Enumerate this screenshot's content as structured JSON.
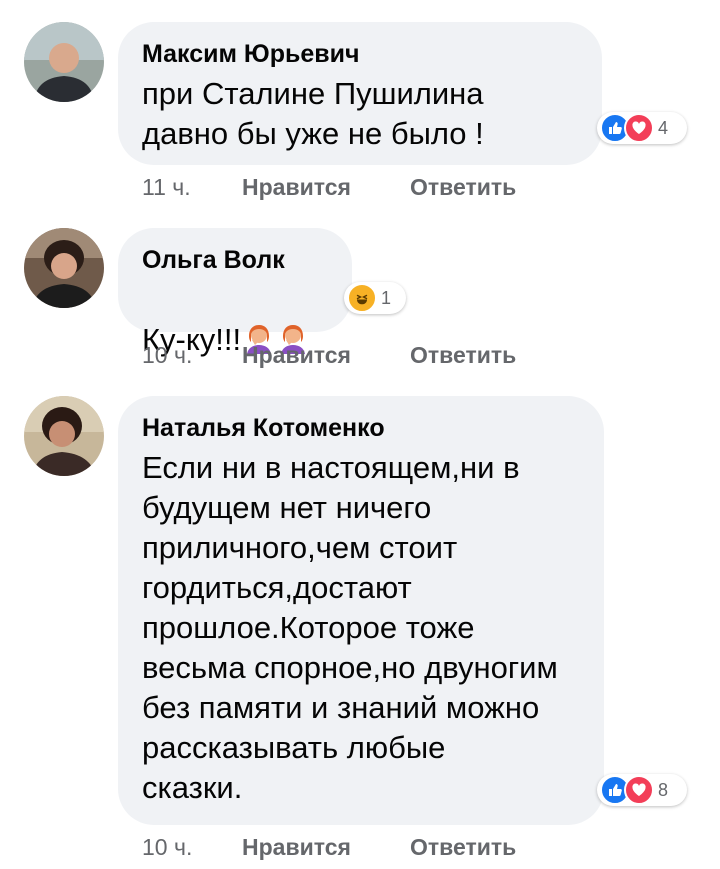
{
  "comments": [
    {
      "author": "Максим Юрьевич",
      "text": "при Сталине Пушилина\nдавно бы уже не было !",
      "reaction_count": "4",
      "time": "11 ч.",
      "like_label": "Нравится",
      "reply_label": "Ответить",
      "reactions": [
        "like-icon",
        "love-icon"
      ]
    },
    {
      "author": "Ольга Волк",
      "text": "Ку-ку!!!",
      "emoji": "face-palm-woman-emoji",
      "reaction_count": "1",
      "time": "10 ч.",
      "like_label": "Нравится",
      "reply_label": "Ответить",
      "reactions": [
        "haha-icon"
      ]
    },
    {
      "author": "Наталья Котоменко",
      "text": "Если ни в настоящем,ни в\nбудущем нет ничего\nприличного,чем стоит\nгордиться,достают\nпрошлое.Которое тоже\nвесьма спорное,но двуногим\nбез памяти и знаний можно\nрассказывать любые\nсказки.",
      "reaction_count": "8",
      "time": "10 ч.",
      "like_label": "Нравится",
      "reply_label": "Ответить",
      "reactions": [
        "like-icon",
        "love-icon"
      ]
    }
  ],
  "colors": {
    "bubble": "#f0f2f5",
    "secondary_text": "#65676b",
    "like": "#1877f2",
    "love": "#f33e58",
    "haha": "#f7b125"
  }
}
